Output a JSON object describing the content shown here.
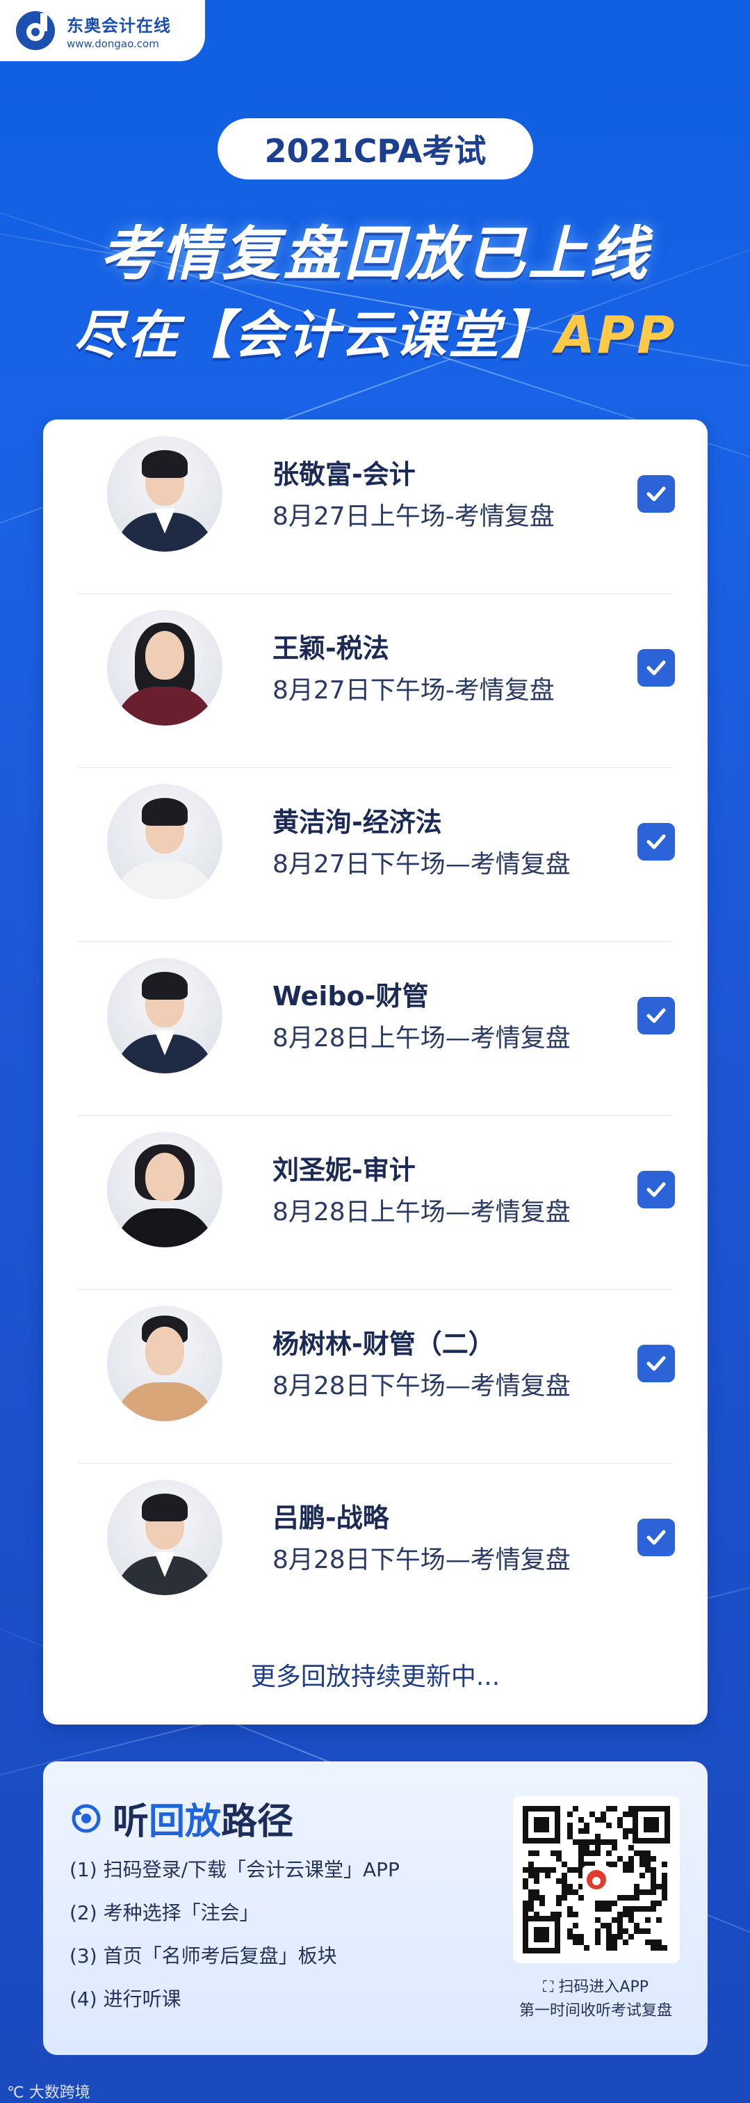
{
  "logo": {
    "name": "东奥会计在线",
    "url": "www.dongao.com"
  },
  "header": {
    "pill": "2021CPA考试",
    "headline": "考情复盘回放已上线",
    "subline_prefix": "尽在【会计云课堂】",
    "subline_app": "APP"
  },
  "teachers": [
    {
      "name": "张敬富-会计",
      "session": "8月27日上午场-考情复盘"
    },
    {
      "name": "王颖-税法",
      "session": "8月27日下午场-考情复盘"
    },
    {
      "name": "黄洁洵-经济法",
      "session": "8月27日下午场—考情复盘"
    },
    {
      "name": "Weibo-财管",
      "session": "8月28日上午场—考情复盘"
    },
    {
      "name": "刘圣妮-审计",
      "session": "8月28日上午场—考情复盘"
    },
    {
      "name": "杨树林-财管（二）",
      "session": "8月28日下午场—考情复盘"
    },
    {
      "name": "吕鹏-战略",
      "session": "8月28日下午场—考情复盘"
    }
  ],
  "more_text": "更多回放持续更新中...",
  "panel": {
    "title_a": "听",
    "title_b": "回放",
    "title_c": "路径",
    "steps": [
      "(1) 扫码登录/下载「会计云课堂」APP",
      "(2) 考种选择「注会」",
      "(3) 首页「名师考后复盘」板块",
      "(4) 进行听课"
    ],
    "qr_caption_1": "扫码进入APP",
    "qr_caption_2": "第一时间收听考试复盘"
  },
  "watermark": "大数跨境",
  "colors": {
    "background": "#1a5ee3",
    "accent": "#2d63d8",
    "app_highlight": "#ffc94a"
  }
}
